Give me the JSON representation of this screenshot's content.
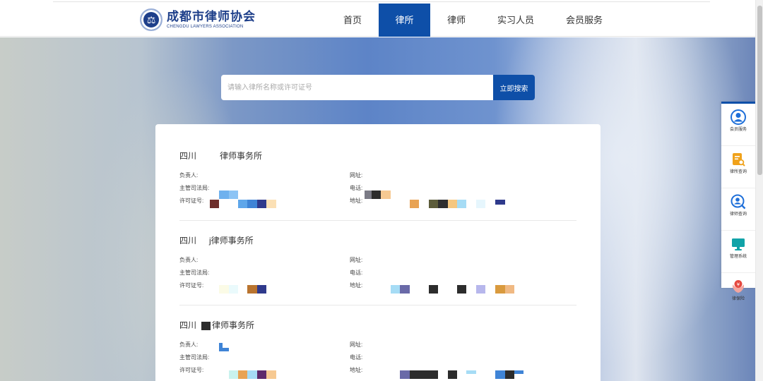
{
  "header": {
    "logo_cn": "成都市律师协会",
    "logo_en": "CHENGDU LAWYERS ASSOCIATION",
    "nav": [
      {
        "label": "首页",
        "active": false
      },
      {
        "label": "律所",
        "active": true
      },
      {
        "label": "律师",
        "active": false
      },
      {
        "label": "实习人员",
        "active": false
      },
      {
        "label": "会员服务",
        "active": false
      }
    ]
  },
  "search": {
    "placeholder": "请输入律所名称或许可证号",
    "button": "立即搜索"
  },
  "labels": {
    "leader": "负责人:",
    "bureau": "主管司法局:",
    "license": "许可证号:",
    "website": "网址:",
    "phone": "电话:",
    "address": "地址:"
  },
  "firms": [
    {
      "province": "四川",
      "suffix": "律师事务所"
    },
    {
      "province": "四川",
      "suffix": "j律师事务所"
    },
    {
      "province": "四川",
      "suffix": "律师事务所"
    }
  ],
  "side": [
    {
      "label": "会员服务",
      "icon": "user-circle-icon",
      "color": "#1e6fd9"
    },
    {
      "label": "律所查询",
      "icon": "document-search-icon",
      "color": "#f0a21b"
    },
    {
      "label": "律师查询",
      "icon": "person-search-icon",
      "color": "#1e6fd9"
    },
    {
      "label": "管理系统",
      "icon": "monitor-icon",
      "color": "#11a3a8"
    },
    {
      "label": "律保险",
      "icon": "insurance-icon",
      "color": "#e5483f"
    }
  ],
  "colors": {
    "accent": "#0e4fa8"
  }
}
